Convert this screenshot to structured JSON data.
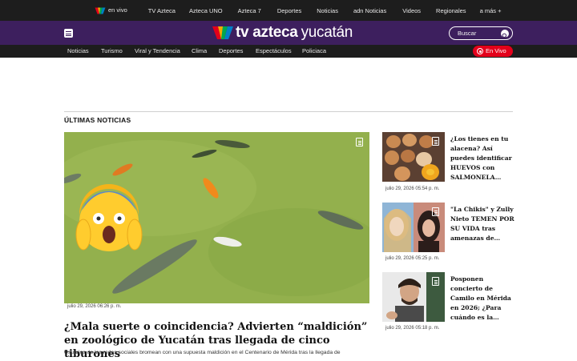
{
  "topbar": {
    "links": [
      {
        "label": "en vivo",
        "has_logo": true
      },
      {
        "label": "TV Azteca"
      },
      {
        "label": "Azteca UNO"
      },
      {
        "label": "Azteca 7"
      },
      {
        "label": "Deportes"
      },
      {
        "label": "Noticias"
      },
      {
        "label": "adn Noticias"
      },
      {
        "label": "Videos"
      },
      {
        "label": "Regionales"
      },
      {
        "label": "a más +"
      }
    ]
  },
  "header": {
    "brand_name": "tv azteca",
    "brand_region": "yucatán",
    "search_placeholder": "Buscar",
    "brand_colors": [
      "#e3001b",
      "#f6a800",
      "#00a650",
      "#0080c8"
    ]
  },
  "nav": {
    "items": [
      "Noticias",
      "Turismo",
      "Viral y Tendencia",
      "Clima",
      "Deportes",
      "Espectáculos",
      "Policiaca"
    ],
    "live_label": "En Vivo"
  },
  "section": {
    "title": "ÚLTIMAS NOTICIAS"
  },
  "hero": {
    "date": "julio 29, 2026 06:26 p. m.",
    "title": "¿Mala suerte o coincidencia? Advierten “maldición” en zoológico de Yucatán tras llegada de cinco tiburones",
    "summary": "Usuarios de las redes sociales bromean con una supuesta maldición en el Centenario de Mérida tras la llegada de",
    "image_icon": "document-icon",
    "emoji": "😱"
  },
  "side": [
    {
      "title": "¿Los tienes en tu alacena? Así puedes identificar HUEVOS con SALMONELA…",
      "date": "julio 29, 2026 05:54 p. m.",
      "image": "eggs"
    },
    {
      "title": "\"La Chikis\" y Zully Nieto TEMEN POR SU VIDA tras amenazas de…",
      "date": "julio 29, 2026 05:25 p. m.",
      "image": "two-women"
    },
    {
      "title": "Posponen concierto de Camilo en Mérida en 2026; ¿Para cuándo es la…",
      "date": "julio 29, 2026 05:18 p. m.",
      "image": "singer"
    }
  ]
}
